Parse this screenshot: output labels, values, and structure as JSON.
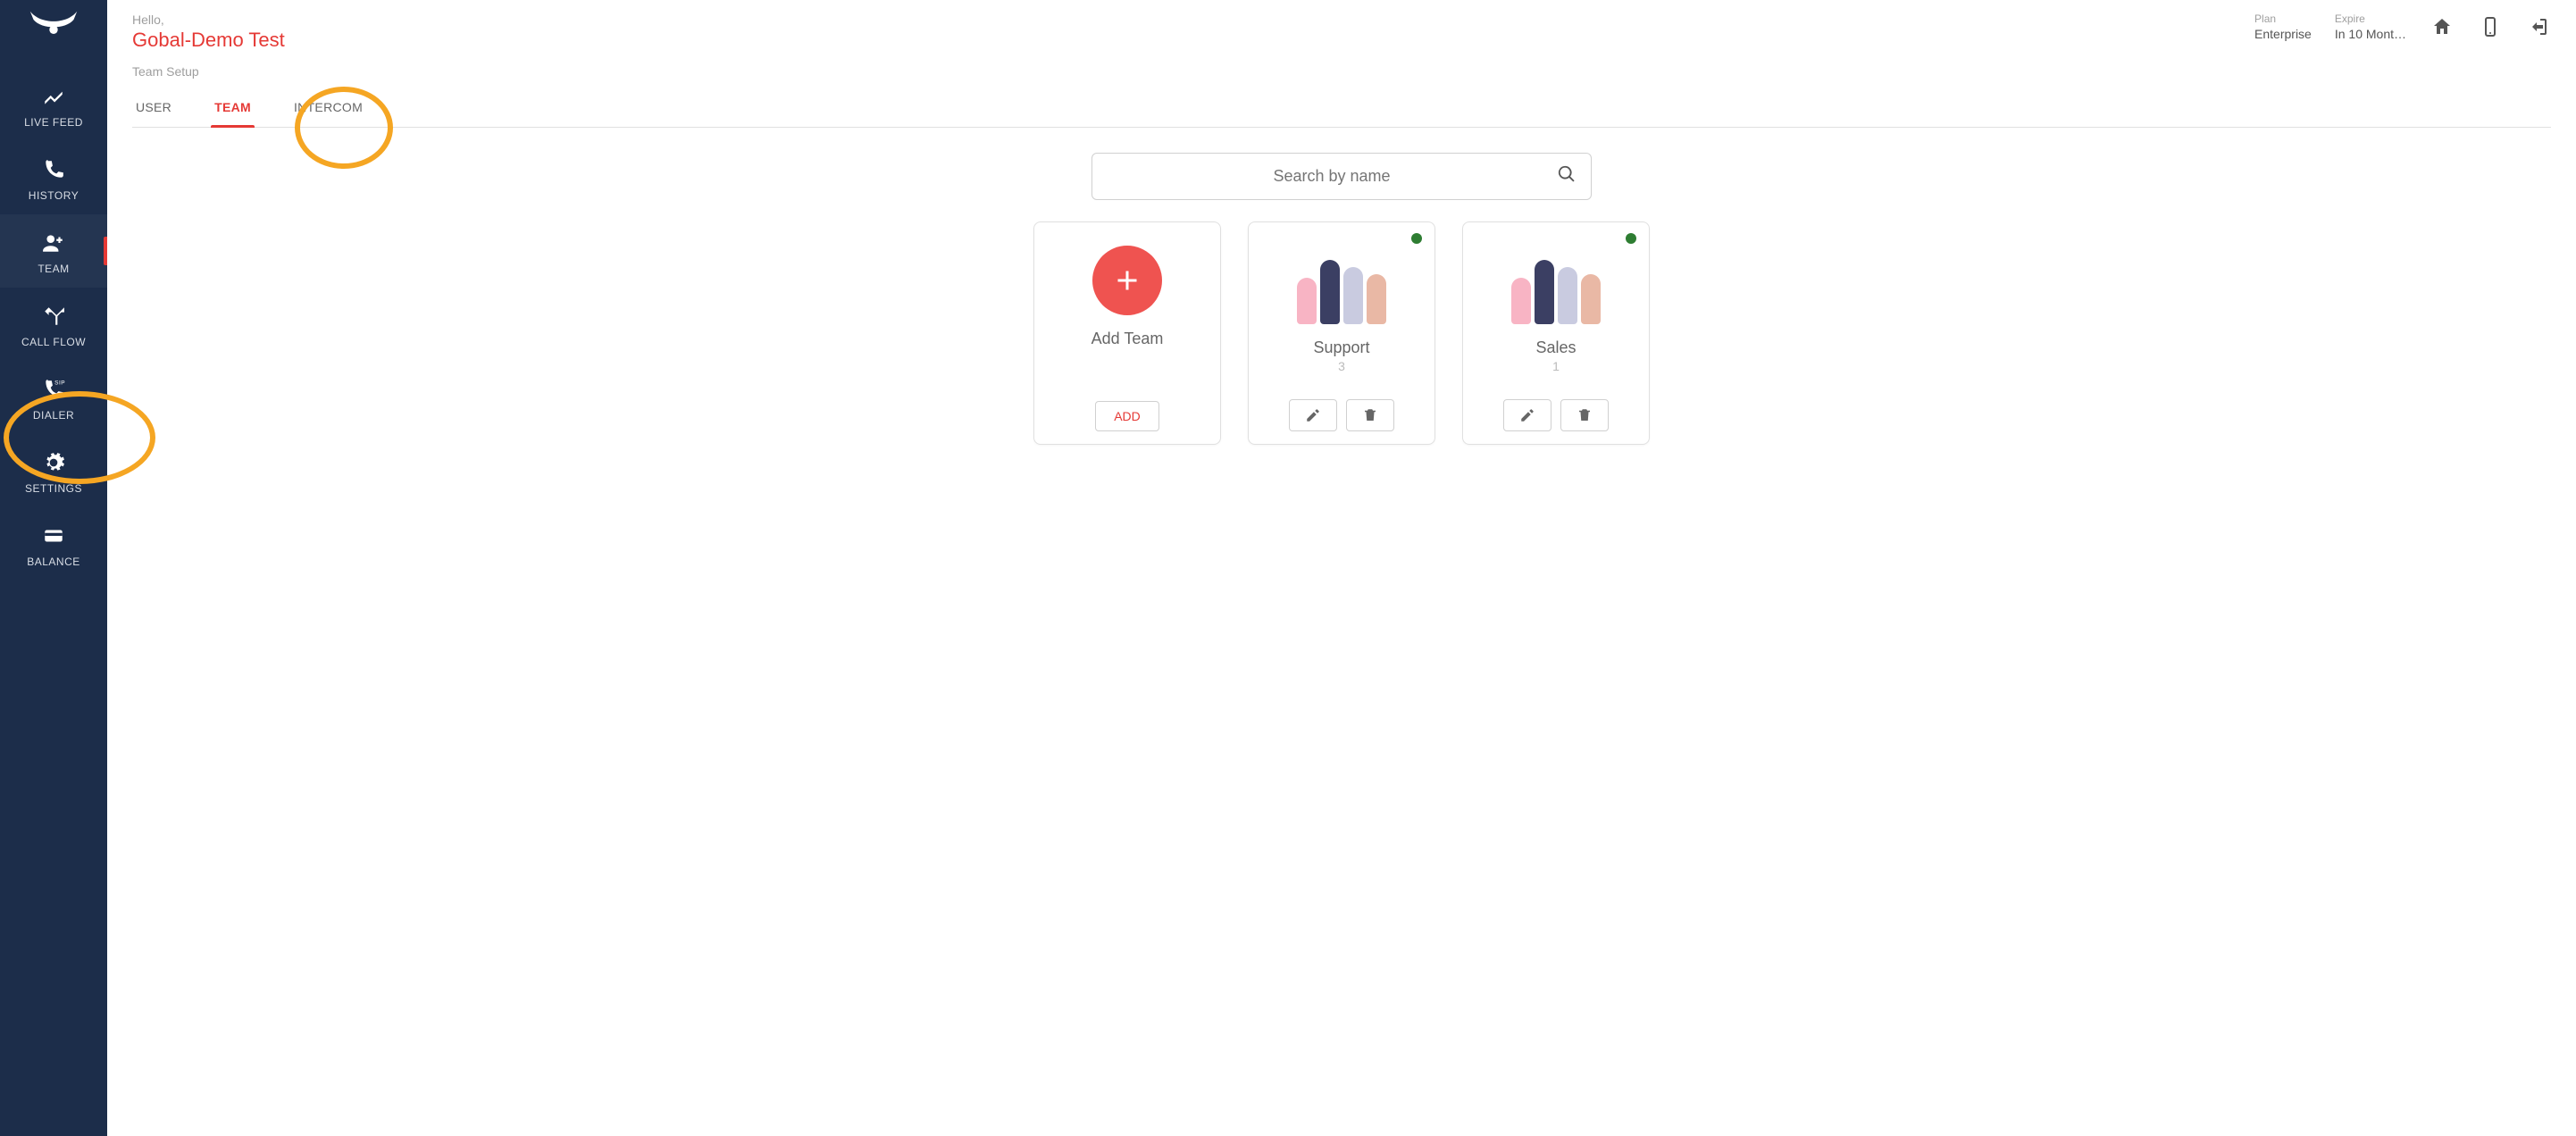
{
  "sidebar": {
    "items": [
      {
        "label": "LIVE FEED"
      },
      {
        "label": "HISTORY"
      },
      {
        "label": "TEAM"
      },
      {
        "label": "CALL FLOW"
      },
      {
        "label": "DIALER"
      },
      {
        "label": "SETTINGS"
      },
      {
        "label": "BALANCE"
      }
    ]
  },
  "header": {
    "hello": "Hello,",
    "user": "Gobal-Demo Test",
    "plan_label": "Plan",
    "plan_value": "Enterprise",
    "expire_label": "Expire",
    "expire_value": "In 10 Mont…"
  },
  "breadcrumb": "Team Setup",
  "tabs": [
    {
      "label": "USER"
    },
    {
      "label": "TEAM"
    },
    {
      "label": "INTERCOM"
    }
  ],
  "search": {
    "placeholder": "Search by name"
  },
  "add_card": {
    "title": "Add Team",
    "button": "ADD"
  },
  "teams": [
    {
      "name": "Support",
      "count": "3"
    },
    {
      "name": "Sales",
      "count": "1"
    }
  ]
}
